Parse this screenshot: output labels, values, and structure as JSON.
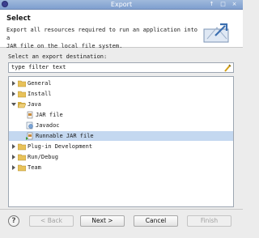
{
  "window": {
    "title": "Export",
    "controls": [
      "↑",
      "□",
      "×"
    ]
  },
  "header": {
    "title": "Select",
    "description_line1": "Export all resources required to run an application into a",
    "description_line2": "JAR file on the local file system."
  },
  "destination_label": "Select an export destination:",
  "filter": {
    "value": "type filter text"
  },
  "tree": [
    {
      "label": "General",
      "expanded": false,
      "level": 0,
      "icon": "folder-icon"
    },
    {
      "label": "Install",
      "expanded": false,
      "level": 0,
      "icon": "folder-icon"
    },
    {
      "label": "Java",
      "expanded": true,
      "level": 0,
      "icon": "folder-icon"
    },
    {
      "label": "JAR file",
      "level": 1,
      "icon": "jar-file-icon"
    },
    {
      "label": "Javadoc",
      "level": 1,
      "icon": "javadoc-icon"
    },
    {
      "label": "Runnable JAR file",
      "level": 1,
      "icon": "runnable-jar-icon",
      "selected": true
    },
    {
      "label": "Plug-in Development",
      "expanded": false,
      "level": 0,
      "icon": "folder-icon"
    },
    {
      "label": "Run/Debug",
      "expanded": false,
      "level": 0,
      "icon": "folder-icon"
    },
    {
      "label": "Team",
      "expanded": false,
      "level": 0,
      "icon": "folder-icon"
    }
  ],
  "buttons": {
    "back": "< Back",
    "next": "Next >",
    "cancel": "Cancel",
    "finish": "Finish"
  },
  "help": "?",
  "colors": {
    "selection": "#c4d8f0",
    "titlebar": "#8aa8d5",
    "folder": "#e8c25a"
  }
}
